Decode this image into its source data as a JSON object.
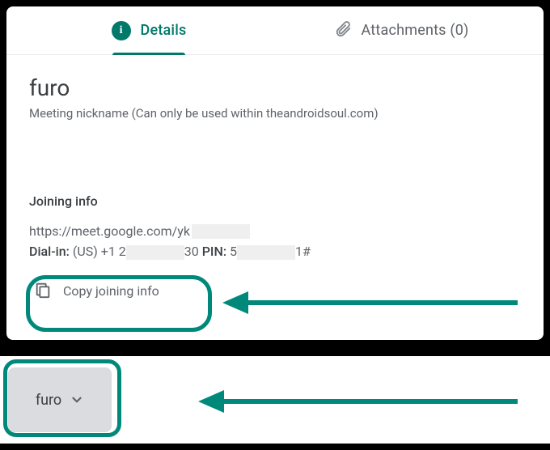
{
  "tabs": {
    "details": {
      "label": "Details"
    },
    "attachments": {
      "label": "Attachments (0)"
    }
  },
  "meeting": {
    "title": "furo",
    "subtitle": "Meeting nickname (Can only be used within theandroidsoul.com)",
    "section_heading": "Joining info",
    "link_prefix": "https://meet.google.com/yk",
    "dial_label": "Dial-in:",
    "dial_prefix": " (US) +1 2",
    "dial_mid": "30  ",
    "pin_label": "PIN:",
    "pin_prefix": " 5",
    "pin_suffix": "1#",
    "copy_label": "Copy joining info"
  },
  "pill": {
    "label": "furo"
  }
}
